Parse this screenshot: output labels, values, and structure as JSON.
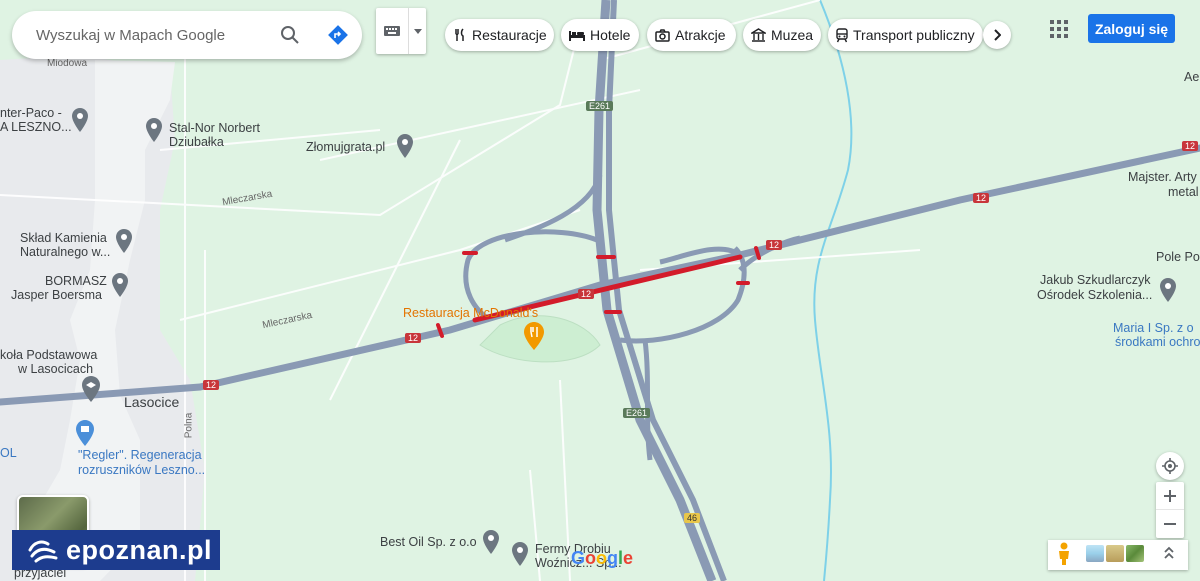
{
  "search": {
    "placeholder": "Wyszukaj w Mapach Google"
  },
  "icons": {
    "search": "search-icon",
    "directions": "directions-icon",
    "keyboard": "keyboard-icon",
    "apps": "apps-grid-icon",
    "location": "my-location-icon",
    "zoom_in": "plus-icon",
    "zoom_out": "minus-icon"
  },
  "categories": [
    {
      "label": "Restauracje",
      "icon": "fork-knife-icon"
    },
    {
      "label": "Hotele",
      "icon": "bed-icon"
    },
    {
      "label": "Atrakcje",
      "icon": "camera-icon"
    },
    {
      "label": "Muzea",
      "icon": "museum-icon"
    },
    {
      "label": "Transport publiczny",
      "icon": "train-icon"
    }
  ],
  "header": {
    "login_label": "Zaloguj się"
  },
  "map": {
    "road_shields": [
      "E261",
      "E261",
      "12",
      "12",
      "12",
      "12",
      "12",
      "12",
      "46"
    ],
    "places": [
      {
        "name": "Stal-Nor Norbert",
        "name2": "Dziubałka"
      },
      {
        "name": "Złomujgrata.pl"
      },
      {
        "name": "Skład Kamienia",
        "name2": "Naturalnego w..."
      },
      {
        "name": "BORMASZ",
        "name2": "Jasper Boersma"
      },
      {
        "name": "Restauracja McDonald's"
      },
      {
        "name": "\"Regler\". Regeneracja",
        "name2": "rozruszników Leszno..."
      },
      {
        "name": "Best Oil Sp. z o.o"
      },
      {
        "name": "Fermy Drobiu",
        "name2": "Woźnicz... Sp..."
      },
      {
        "name": "Jakub Szkudlarczyk",
        "name2": "Ośrodek Szkolenia..."
      },
      {
        "name": "Majster. Arty",
        "name2": "metal"
      },
      {
        "name": "Maria I Sp. z o",
        "name2": "środkami ochro"
      },
      {
        "name": "Pole Po"
      },
      {
        "name": "nter-Paco -",
        "name2": "A LESZNO..."
      },
      {
        "name": "koła Podstawowa",
        "name2": "w Lasocicach"
      }
    ],
    "town": "Lasocice",
    "streets": [
      "Miodowa",
      "Mleczarska",
      "Mleczarska",
      "Polna"
    ],
    "edge_labels": [
      "Ae",
      "OL",
      "przyjaciel"
    ]
  },
  "branding": {
    "watermark": "epoznan.pl",
    "google": "Google"
  }
}
